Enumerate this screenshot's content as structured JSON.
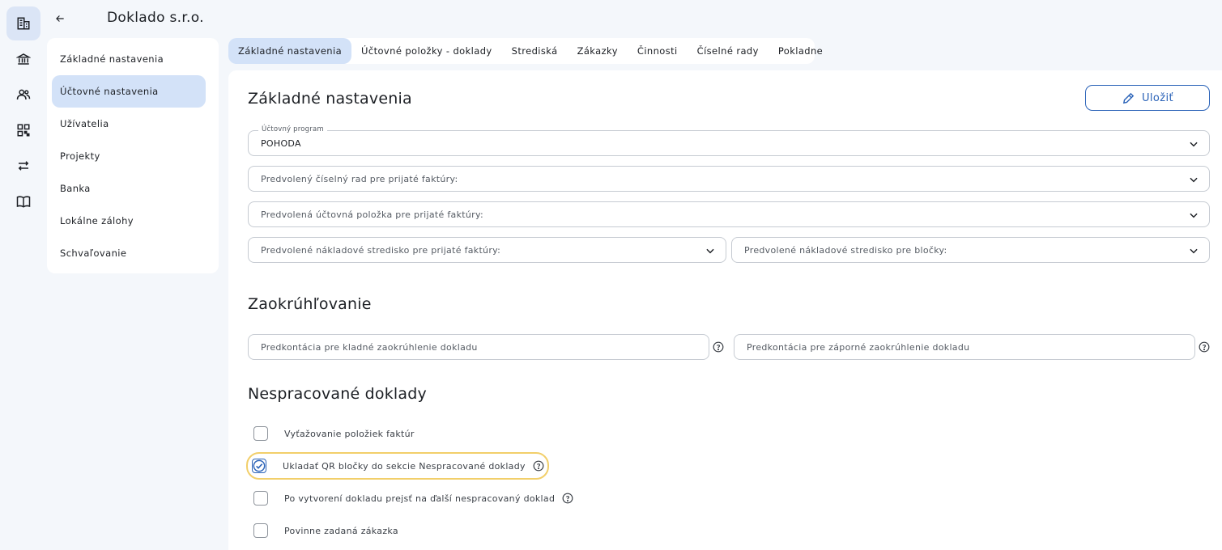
{
  "company": {
    "name": "Doklado s.r.o."
  },
  "rail": {
    "items": [
      {
        "icon": "buildings-icon",
        "active": true
      },
      {
        "icon": "bank-icon",
        "active": false
      },
      {
        "icon": "users-icon",
        "active": false
      },
      {
        "icon": "qr-code-icon",
        "active": false
      },
      {
        "icon": "transfer-arrows-icon",
        "active": false
      },
      {
        "icon": "book-icon",
        "active": false
      }
    ]
  },
  "sidemenu": {
    "items": [
      {
        "label": "Základné nastavenia"
      },
      {
        "label": "Účtovné nastavenia"
      },
      {
        "label": "Užívatelia"
      },
      {
        "label": "Projekty"
      },
      {
        "label": "Banka"
      },
      {
        "label": "Lokálne zálohy"
      },
      {
        "label": "Schvaľovanie"
      }
    ],
    "active_index": 1
  },
  "tabs": {
    "items": [
      {
        "label": "Základné nastavenia"
      },
      {
        "label": "Účtovné položky - doklady"
      },
      {
        "label": "Strediská"
      },
      {
        "label": "Zákazky"
      },
      {
        "label": "Činnosti"
      },
      {
        "label": "Číselné rady"
      },
      {
        "label": "Pokladne"
      }
    ],
    "active_index": 0
  },
  "main": {
    "title": "Základné nastavenia",
    "save_label": "Uložiť",
    "accounting_program": {
      "legend": "Účtovný program",
      "value": "POHODA"
    },
    "default_number_series": {
      "placeholder": "Predvolený číselný rad pre prijaté faktúry:"
    },
    "default_accounting_item": {
      "placeholder": "Predvolená účtovná položka pre prijaté faktúry:"
    },
    "default_cost_center_invoices": {
      "placeholder": "Predvolené nákladové stredisko pre prijaté faktúry:"
    },
    "default_cost_center_receipts": {
      "placeholder": "Predvolené nákladové stredisko pre bločky:"
    }
  },
  "rounding": {
    "title": "Zaokrúhľovanie",
    "positive_placeholder": "Predkontácia pre kladné zaokrúhlenie dokladu",
    "negative_placeholder": "Predkontácia pre záporné zaokrúhlenie dokladu"
  },
  "unprocessed": {
    "title": "Nespracované doklady",
    "options": [
      {
        "label": "Vyťažovanie položiek faktúr",
        "checked": false,
        "help": false
      },
      {
        "label": "Ukladať QR bločky do sekcie Nespracované doklady",
        "checked": true,
        "help": true
      },
      {
        "label": "Po vytvorení dokladu prejsť na ďalší nespracovaný doklad",
        "checked": false,
        "help": true
      },
      {
        "label": "Povinne zadaná zákazka",
        "checked": false,
        "help": false
      }
    ]
  },
  "colors": {
    "accent": "#2b63b8",
    "active_bg": "#d3e2f8",
    "focus_ring": "#f2cf6a",
    "page_bg": "#f4f7fb"
  }
}
